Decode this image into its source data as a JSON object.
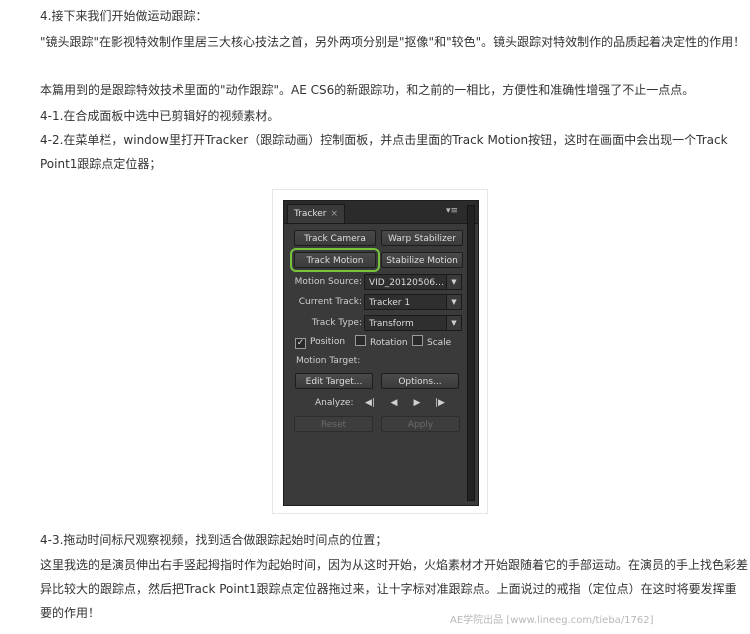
{
  "paragraphs": {
    "p1": "4.接下来我们开始做运动跟踪：",
    "p2": "\"镜头跟踪\"在影视特效制作里居三大核心技法之首，另外两项分别是\"抠像\"和\"较色\"。镜头跟踪对特效制作的品质起着决定性的作用！",
    "p3": "本篇用到的是跟踪特效技术里面的\"动作跟踪\"。AE CS6的新跟踪功，和之前的一相比，方便性和准确性增强了不止一点点。",
    "p4": "4-1.在合成面板中选中已剪辑好的视频素材。",
    "p5": "4-2.在菜单栏，window里打开Tracker（跟踪动画）控制面板，并点击里面的Track Motion按钮，这时在画面中会出现一个Track Point1跟踪点定位器；",
    "p6": "4-3.拖动时间标尺观察视频，找到适合做跟踪起始时间点的位置；",
    "p7": "这里我选的是演员伸出右手竖起拇指时作为起始时间，因为从这时开始，火焰素材才开始跟随着它的手部运动。在演员的手上找色彩差异比较大的跟踪点，然后把Track Point1跟踪点定位器拖过来，让十字标对准跟踪点。上面说过的戒指（定位点）在这时将要发挥重要的作用！"
  },
  "tracker": {
    "tab_title": "Tracker",
    "tab_close": "×",
    "menu_icon": "▾≡",
    "track_camera": "Track Camera",
    "warp_stabilizer": "Warp Stabilizer",
    "track_motion": "Track Motion",
    "stabilize_motion": "Stabilize Motion",
    "motion_source_label": "Motion Source:",
    "motion_source_value": "VID_20120506…",
    "current_track_label": "Current Track:",
    "current_track_value": "Tracker 1",
    "track_type_label": "Track Type:",
    "track_type_value": "Transform",
    "position_label": "Position",
    "position_checked": "✓",
    "rotation_label": "Rotation",
    "scale_label": "Scale",
    "motion_target_label": "Motion Target:",
    "edit_target": "Edit Target...",
    "options": "Options...",
    "analyze_label": "Analyze:",
    "analyze_back_frame": "◀|",
    "analyze_back": "◀",
    "analyze_forward": "▶",
    "analyze_forward_frame": "|▶",
    "reset": "Reset",
    "apply": "Apply",
    "dropdown_arrow": "▼"
  },
  "watermark": "AE学院出品  [www.lineeg.com/tieba/1762]"
}
